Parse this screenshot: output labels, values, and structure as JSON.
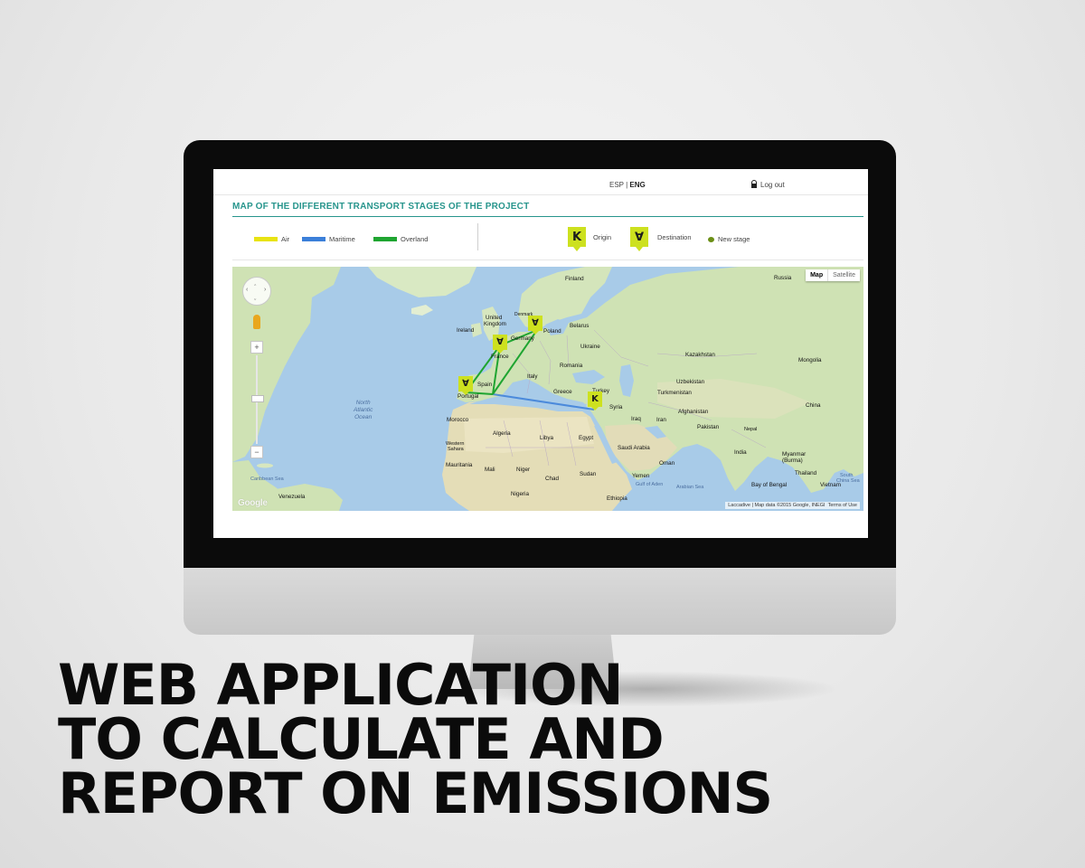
{
  "app": {
    "lang_esp": "ESP",
    "lang_sep": "|",
    "lang_eng": "ENG",
    "logout": "Log out",
    "title": "MAP OF THE DIFFERENT TRANSPORT STAGES OF THE PROJECT"
  },
  "legend": {
    "modes": [
      {
        "label": "Air",
        "color": "#e8e312"
      },
      {
        "label": "Maritime",
        "color": "#3b7fd9"
      },
      {
        "label": "Overland",
        "color": "#1fa531"
      }
    ],
    "origin_icon": "K",
    "origin_label": "Origin",
    "destination_icon": "∀",
    "destination_label": "Destination",
    "new_stage_label": "New stage"
  },
  "map": {
    "view_map": "Map",
    "view_satellite": "Satellite",
    "attribution": "Map data ©2015 Google, INEGI",
    "terms": "Terms of Use",
    "laccadive": "Laccadive",
    "google": "Google",
    "zoom_in": "+",
    "zoom_out": "−",
    "labels": {
      "finland": "Finland",
      "russia": "Russia",
      "united_kingdom_1": "United",
      "united_kingdom_2": "Kingdom",
      "denmark": "Denmark",
      "ireland": "Ireland",
      "belarus": "Belarus",
      "poland": "Poland",
      "germany": "Germany",
      "ukraine": "Ukraine",
      "france": "France",
      "romania": "Romania",
      "kazakhstan": "Kazakhstan",
      "mongolia": "Mongolia",
      "italy": "Italy",
      "spain": "Spain",
      "portugal": "Portugal",
      "greece": "Greece",
      "turkey": "Turkey",
      "uzbekistan": "Uzbekistan",
      "turkmenistan": "Turkmenistan",
      "china": "China",
      "syria": "Syria",
      "afghanistan": "Afghanistan",
      "iraq": "Iraq",
      "iran": "Iran",
      "pakistan": "Pakistan",
      "morocco": "Morocco",
      "algeria": "Algeria",
      "libya": "Libya",
      "egypt": "Egypt",
      "saudi_arabia": "Saudi Arabia",
      "india": "India",
      "nepal": "Nepal",
      "myanmar_1": "Myanmar",
      "myanmar_2": "(Burma)",
      "western_sahara_1": "Western",
      "western_sahara_2": "Sahara",
      "mauritania": "Mauritania",
      "mali": "Mali",
      "niger": "Niger",
      "chad": "Chad",
      "sudan": "Sudan",
      "yemen": "Yemen",
      "oman": "Oman",
      "bay_of_bengal": "Bay of Bengal",
      "thailand": "Thailand",
      "vietnam": "Vietnam",
      "south_china_sea_1": "South",
      "south_china_sea_2": "China Sea",
      "arabian_sea": "Arabian Sea",
      "gulf_of_aden": "Gulf of Aden",
      "nigeria": "Nigeria",
      "ethiopia": "Ethiopia",
      "venezuela": "Venezuela",
      "caribbean_sea": "Caribbean Sea",
      "north_atlantic_1": "North",
      "north_atlantic_2": "Atlantic",
      "north_atlantic_3": "Ocean"
    },
    "markers": [
      {
        "type": "destination",
        "icon": "∀",
        "place": "Germany / Poland"
      },
      {
        "type": "destination",
        "icon": "∀",
        "place": "France"
      },
      {
        "type": "destination",
        "icon": "∀",
        "place": "Portugal"
      },
      {
        "type": "origin",
        "icon": "K",
        "place": "Syria coast"
      }
    ],
    "routes": [
      {
        "mode": "Overland",
        "color": "#1fa531"
      },
      {
        "mode": "Maritime",
        "color": "#3b7fd9"
      }
    ]
  },
  "headline": {
    "line1": "WEB APPLICATION",
    "line2": "TO CALCULATE AND",
    "line3": "REPORT ON EMISSIONS"
  }
}
